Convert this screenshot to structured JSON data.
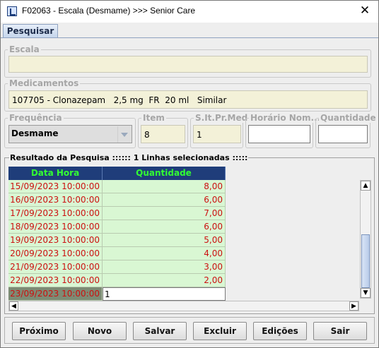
{
  "window": {
    "title": "F02063 - Escala (Desmame) >>> Senior Care",
    "close_glyph": "✕"
  },
  "tab": {
    "label": "Pesquisar"
  },
  "escala": {
    "label": "Escala",
    "value": ""
  },
  "medicamentos": {
    "label": "Medicamentos",
    "value": "107705 - Clonazepam   2,5 mg  FR  20 ml   Similar"
  },
  "frequencia": {
    "label": "Frequência",
    "value": "Desmame"
  },
  "item": {
    "label": "Item",
    "value": "8"
  },
  "situacao": {
    "label": "S.It.Pr.Med",
    "value": "1"
  },
  "horario": {
    "label": "Horário Nom...",
    "value": ""
  },
  "quantidade": {
    "label": "Quantidade",
    "value": ""
  },
  "results": {
    "label": "Resultado da Pesquisa :::::: 1 Linhas selecionadas :::::",
    "columns": [
      "Data Hora",
      "Quantidade"
    ],
    "rows": [
      {
        "data_hora": "15/09/2023 10:00:00",
        "quantidade": "8,00"
      },
      {
        "data_hora": "16/09/2023 10:00:00",
        "quantidade": "6,00"
      },
      {
        "data_hora": "17/09/2023 10:00:00",
        "quantidade": "7,00"
      },
      {
        "data_hora": "18/09/2023 10:00:00",
        "quantidade": "6,00"
      },
      {
        "data_hora": "19/09/2023 10:00:00",
        "quantidade": "5,00"
      },
      {
        "data_hora": "20/09/2023 10:00:00",
        "quantidade": "4,00"
      },
      {
        "data_hora": "21/09/2023 10:00:00",
        "quantidade": "3,00"
      },
      {
        "data_hora": "22/09/2023 10:00:00",
        "quantidade": "2,00"
      },
      {
        "data_hora": "23/09/2023 10:00:00",
        "quantidade": "1"
      }
    ]
  },
  "buttons": {
    "proximo": "Próximo",
    "novo": "Novo",
    "salvar": "Salvar",
    "excluir": "Excluir",
    "edicoes": "Edições",
    "sair": "Sair"
  },
  "colors": {
    "header_bg": "#1f3d7a",
    "header_text": "#33ff33",
    "row_bg": "#d9f7d3",
    "row_text": "#cc1010",
    "readonly_bg": "#f3f1d8"
  },
  "icons": {
    "app": "senior-care-app-icon",
    "close": "close-icon",
    "combo": "chevron-down-icon"
  }
}
